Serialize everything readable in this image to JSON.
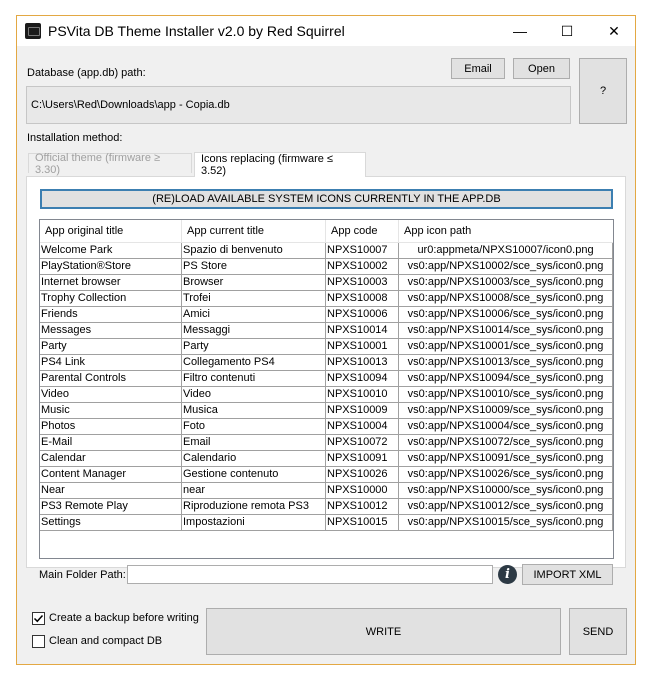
{
  "window": {
    "title": "PSVita DB Theme Installer v2.0 by Red Squirrel",
    "minimize_glyph": "—",
    "maximize_glyph": "☐",
    "close_glyph": "✕"
  },
  "database": {
    "label": "Database (app.db) path:",
    "path": "C:\\Users\\Red\\Downloads\\app - Copia.db",
    "email_label": "Email",
    "open_label": "Open",
    "help_label": "?"
  },
  "install": {
    "label": "Installation method:",
    "tabs": [
      {
        "label": "Official theme (firmware ≥ 3.30)",
        "active": false
      },
      {
        "label": "Icons replacing (firmware ≤ 3.52)",
        "active": true
      }
    ],
    "reload_label": "(RE)LOAD AVAILABLE SYSTEM ICONS CURRENTLY IN THE APP.DB"
  },
  "table": {
    "columns": [
      "App original title",
      "App current title",
      "App code",
      "App icon path"
    ],
    "rows": [
      [
        "Welcome Park",
        "Spazio di benvenuto",
        "NPXS10007",
        "ur0:appmeta/NPXS10007/icon0.png"
      ],
      [
        "PlayStation®Store",
        "PS Store",
        "NPXS10002",
        "vs0:app/NPXS10002/sce_sys/icon0.png"
      ],
      [
        "Internet browser",
        "Browser",
        "NPXS10003",
        "vs0:app/NPXS10003/sce_sys/icon0.png"
      ],
      [
        "Trophy Collection",
        "Trofei",
        "NPXS10008",
        "vs0:app/NPXS10008/sce_sys/icon0.png"
      ],
      [
        "Friends",
        "Amici",
        "NPXS10006",
        "vs0:app/NPXS10006/sce_sys/icon0.png"
      ],
      [
        "Messages",
        "Messaggi",
        "NPXS10014",
        "vs0:app/NPXS10014/sce_sys/icon0.png"
      ],
      [
        "Party",
        "Party",
        "NPXS10001",
        "vs0:app/NPXS10001/sce_sys/icon0.png"
      ],
      [
        "PS4 Link",
        "Collegamento PS4",
        "NPXS10013",
        "vs0:app/NPXS10013/sce_sys/icon0.png"
      ],
      [
        "Parental Controls",
        "Filtro contenuti",
        "NPXS10094",
        "vs0:app/NPXS10094/sce_sys/icon0.png"
      ],
      [
        "Video",
        "Video",
        "NPXS10010",
        "vs0:app/NPXS10010/sce_sys/icon0.png"
      ],
      [
        "Music",
        "Musica",
        "NPXS10009",
        "vs0:app/NPXS10009/sce_sys/icon0.png"
      ],
      [
        "Photos",
        "Foto",
        "NPXS10004",
        "vs0:app/NPXS10004/sce_sys/icon0.png"
      ],
      [
        "E-Mail",
        "Email",
        "NPXS10072",
        "vs0:app/NPXS10072/sce_sys/icon0.png"
      ],
      [
        "Calendar",
        "Calendario",
        "NPXS10091",
        "vs0:app/NPXS10091/sce_sys/icon0.png"
      ],
      [
        "Content Manager",
        "Gestione contenuto",
        "NPXS10026",
        "vs0:app/NPXS10026/sce_sys/icon0.png"
      ],
      [
        "Near",
        "near",
        "NPXS10000",
        "vs0:app/NPXS10000/sce_sys/icon0.png"
      ],
      [
        "PS3 Remote Play",
        "Riproduzione remota PS3",
        "NPXS10012",
        "vs0:app/NPXS10012/sce_sys/icon0.png"
      ],
      [
        "Settings",
        "Impostazioni",
        "NPXS10015",
        "vs0:app/NPXS10015/sce_sys/icon0.png"
      ]
    ]
  },
  "folder": {
    "label": "Main Folder Path:",
    "value": "",
    "info_glyph": "i",
    "import_label": "IMPORT XML"
  },
  "options": {
    "backup_label": "Create a backup before writing",
    "backup_checked": true,
    "clean_label": "Clean and compact DB",
    "clean_checked": false
  },
  "actions": {
    "write_label": "WRITE",
    "send_label": "SEND"
  },
  "colors": {
    "window_border": "#e3a843",
    "reload_border": "#3c7fb1",
    "info_icon": "#2d3a45"
  }
}
